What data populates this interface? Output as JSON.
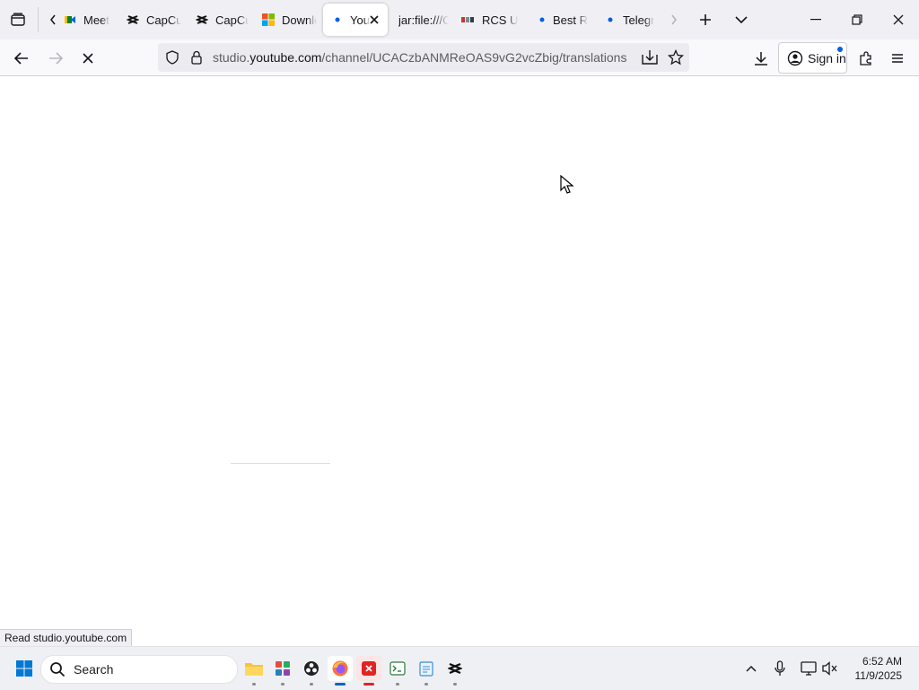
{
  "browser": {
    "tabs": [
      {
        "label": "Meet",
        "favicon": "google-meet-icon"
      },
      {
        "label": "CapCut",
        "favicon": "capcut-icon"
      },
      {
        "label": "CapCut",
        "favicon": "capcut-icon"
      },
      {
        "label": "Download",
        "favicon": "microsoft-icon"
      },
      {
        "label": "You",
        "favicon": "loading-dot-icon",
        "active": true
      },
      {
        "label": "jar:file:///C",
        "favicon": "none"
      },
      {
        "label": "RCS U",
        "favicon": "rcs-icon"
      },
      {
        "label": "Best R",
        "favicon": "loading-dot-icon"
      },
      {
        "label": "Telegr",
        "favicon": "loading-dot-icon"
      }
    ],
    "url": {
      "prefix": "studio.",
      "domain": "youtube.com",
      "path": "/channel/UCACzbANMReOAS9vG2vcZbig/translations"
    },
    "sign_in_label": "Sign in",
    "status_text": "Read studio.youtube.com",
    "accent_color": "#0060df"
  },
  "taskbar": {
    "search_placeholder": "Search",
    "time": "6:52 AM",
    "date": "11/9/2025",
    "apps": [
      "file-explorer-icon",
      "app-grid-icon",
      "obs-icon",
      "firefox-icon",
      "red-app-icon",
      "terminal-icon",
      "notepad-icon",
      "capcut-icon"
    ]
  }
}
